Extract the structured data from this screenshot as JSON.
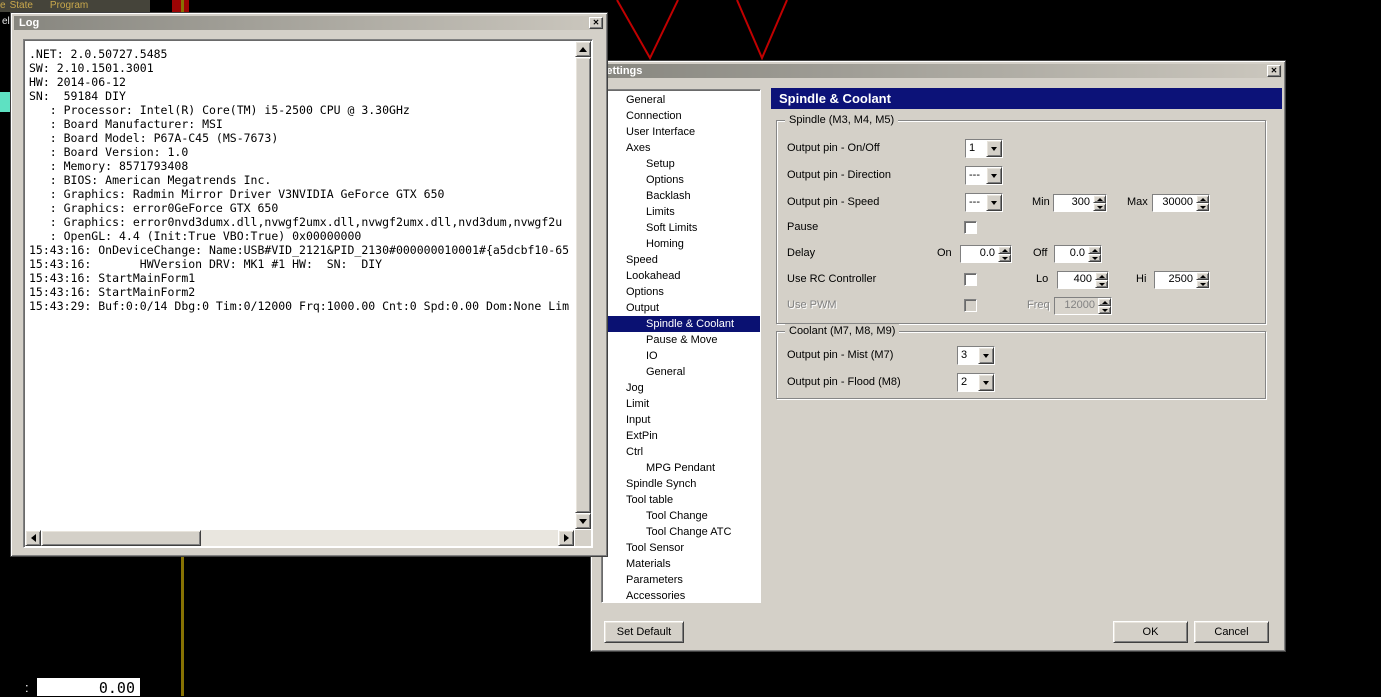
{
  "icons": {
    "close": "✕"
  },
  "background": {
    "menu_items": [
      {
        "label": "e"
      },
      {
        "label": "State"
      },
      {
        "label": "Program"
      }
    ],
    "edge_text": "el",
    "dro": {
      "prefix": ":",
      "value": "0.00"
    },
    "colors": {
      "toolpath_red": "#c00000",
      "olive_line": "#877203",
      "teal_fragment": "#5ee1c2"
    }
  },
  "log_window": {
    "title": "Log",
    "lines": [
      ".NET: 2.0.50727.5485",
      "SW: 2.10.1501.3001",
      "HW: 2014-06-12",
      "SN:  59184 DIY",
      "   : Processor: Intel(R) Core(TM) i5-2500 CPU @ 3.30GHz",
      "   : Board Manufacturer: MSI",
      "   : Board Model: P67A-C45 (MS-7673)",
      "   : Board Version: 1.0",
      "   : Memory: 8571793408",
      "   : BIOS: American Megatrends Inc.",
      "   : Graphics: Radmin Mirror Driver V3NVIDIA GeForce GTX 650",
      "   : Graphics: error0GeForce GTX 650",
      "   : Graphics: error0nvd3dumx.dll,nvwgf2umx.dll,nvwgf2umx.dll,nvd3dum,nvwgf2u",
      "   : OpenGL: 4.4 (Init:True VBO:True) 0x00000000",
      "15:43:16: OnDeviceChange: Name:USB#VID_2121&PID_2130#000000010001#{a5dcbf10-65",
      "15:43:16:       HWVersion DRV: MK1 #1 HW:  SN:  DIY",
      "15:43:16: StartMainForm1",
      "15:43:16: StartMainForm2",
      "15:43:29: Buf:0:0/14 Dbg:0 Tim:0/12000 Frq:1000.00 Cnt:0 Spd:0.00 Dom:None Lim"
    ]
  },
  "settings_window": {
    "title": "Settings",
    "tree_items": [
      {
        "label": "General",
        "indent": 0
      },
      {
        "label": "Connection",
        "indent": 0
      },
      {
        "label": "User Interface",
        "indent": 0
      },
      {
        "label": "Axes",
        "indent": 0
      },
      {
        "label": "Setup",
        "indent": 1
      },
      {
        "label": "Options",
        "indent": 1
      },
      {
        "label": "Backlash",
        "indent": 1
      },
      {
        "label": "Limits",
        "indent": 1
      },
      {
        "label": "Soft Limits",
        "indent": 1
      },
      {
        "label": "Homing",
        "indent": 1
      },
      {
        "label": "Speed",
        "indent": 0
      },
      {
        "label": "Lookahead",
        "indent": 0
      },
      {
        "label": "Options",
        "indent": 0
      },
      {
        "label": "Output",
        "indent": 0
      },
      {
        "label": "Spindle & Coolant",
        "indent": 1,
        "selected": true
      },
      {
        "label": "Pause & Move",
        "indent": 1
      },
      {
        "label": "IO",
        "indent": 1
      },
      {
        "label": "General",
        "indent": 1
      },
      {
        "label": "Jog",
        "indent": 0
      },
      {
        "label": "Limit",
        "indent": 0
      },
      {
        "label": "Input",
        "indent": 0
      },
      {
        "label": "ExtPin",
        "indent": 0
      },
      {
        "label": "Ctrl",
        "indent": 0
      },
      {
        "label": "MPG Pendant",
        "indent": 1
      },
      {
        "label": "Spindle Synch",
        "indent": 0
      },
      {
        "label": "Tool table",
        "indent": 0
      },
      {
        "label": "Tool Change",
        "indent": 1
      },
      {
        "label": "Tool Change ATC",
        "indent": 1
      },
      {
        "label": "Tool Sensor",
        "indent": 0
      },
      {
        "label": "Materials",
        "indent": 0
      },
      {
        "label": "Parameters",
        "indent": 0
      },
      {
        "label": "Accessories",
        "indent": 0
      }
    ],
    "panel": {
      "header": "Spindle & Coolant",
      "spindle": {
        "legend": "Spindle (M3, M4, M5)",
        "on_off_label": "Output pin - On/Off",
        "on_off_value": "1",
        "direction_label": "Output pin - Direction",
        "direction_value": "---",
        "speed_label": "Output pin - Speed",
        "speed_value": "---",
        "min_label": "Min",
        "min_value": "300",
        "max_label": "Max",
        "max_value": "30000",
        "pause_label": "Pause",
        "delay_label": "Delay",
        "on_label": "On",
        "delay_on_value": "0.0",
        "off_label": "Off",
        "delay_off_value": "0.0",
        "rc_label": "Use RC Controller",
        "lo_label": "Lo",
        "lo_value": "400",
        "hi_label": "Hi",
        "hi_value": "2500",
        "pwm_label": "Use PWM",
        "freq_label": "Freq",
        "freq_value": "12000"
      },
      "coolant": {
        "legend": "Coolant (M7, M8, M9)",
        "mist_label": "Output pin - Mist (M7)",
        "mist_value": "3",
        "flood_label": "Output pin - Flood (M8)",
        "flood_value": "2"
      }
    },
    "buttons": {
      "set_default": "Set Default",
      "ok": "OK",
      "cancel": "Cancel"
    }
  }
}
